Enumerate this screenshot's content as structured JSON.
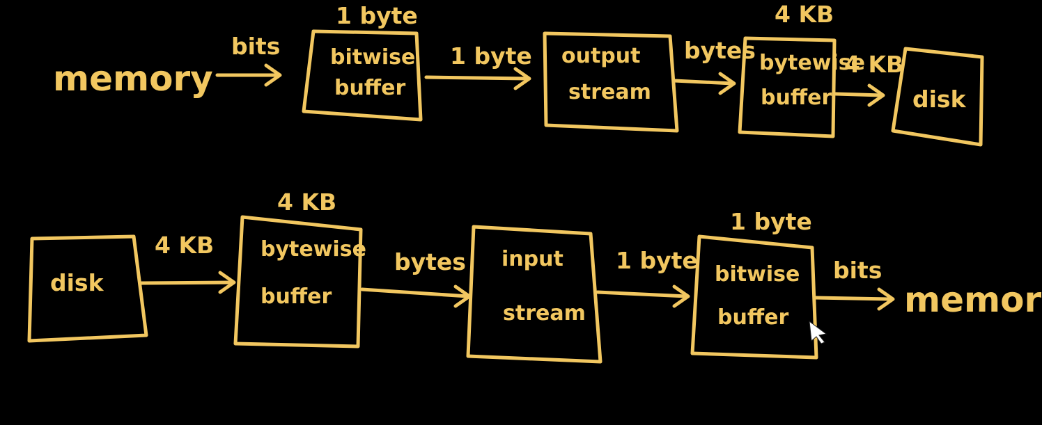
{
  "colors": {
    "background": "#000000",
    "ink": "#f2c760"
  },
  "write_pipeline": {
    "source": "memory",
    "arrow_1": "bits",
    "box_1": {
      "top_label": "1 byte",
      "line1": "bitwise",
      "line2": "buffer"
    },
    "arrow_2": "1 byte",
    "box_2": {
      "line1": "output",
      "line2": "stream"
    },
    "arrow_3": "bytes",
    "box_3": {
      "top_label": "4 KB",
      "line1": "bytewise",
      "line2": "buffer"
    },
    "arrow_4": "4 KB",
    "sink": "disk"
  },
  "read_pipeline": {
    "source": "disk",
    "arrow_1": "4 KB",
    "box_1": {
      "top_label": "4 KB",
      "line1": "bytewise",
      "line2": "buffer"
    },
    "arrow_2": "bytes",
    "box_2": {
      "line1": "input",
      "line2": "stream"
    },
    "arrow_3": "1 byte",
    "box_3": {
      "top_label": "1 byte",
      "line1": "bitwise",
      "line2": "buffer"
    },
    "arrow_4": "bits",
    "sink": "memory"
  }
}
